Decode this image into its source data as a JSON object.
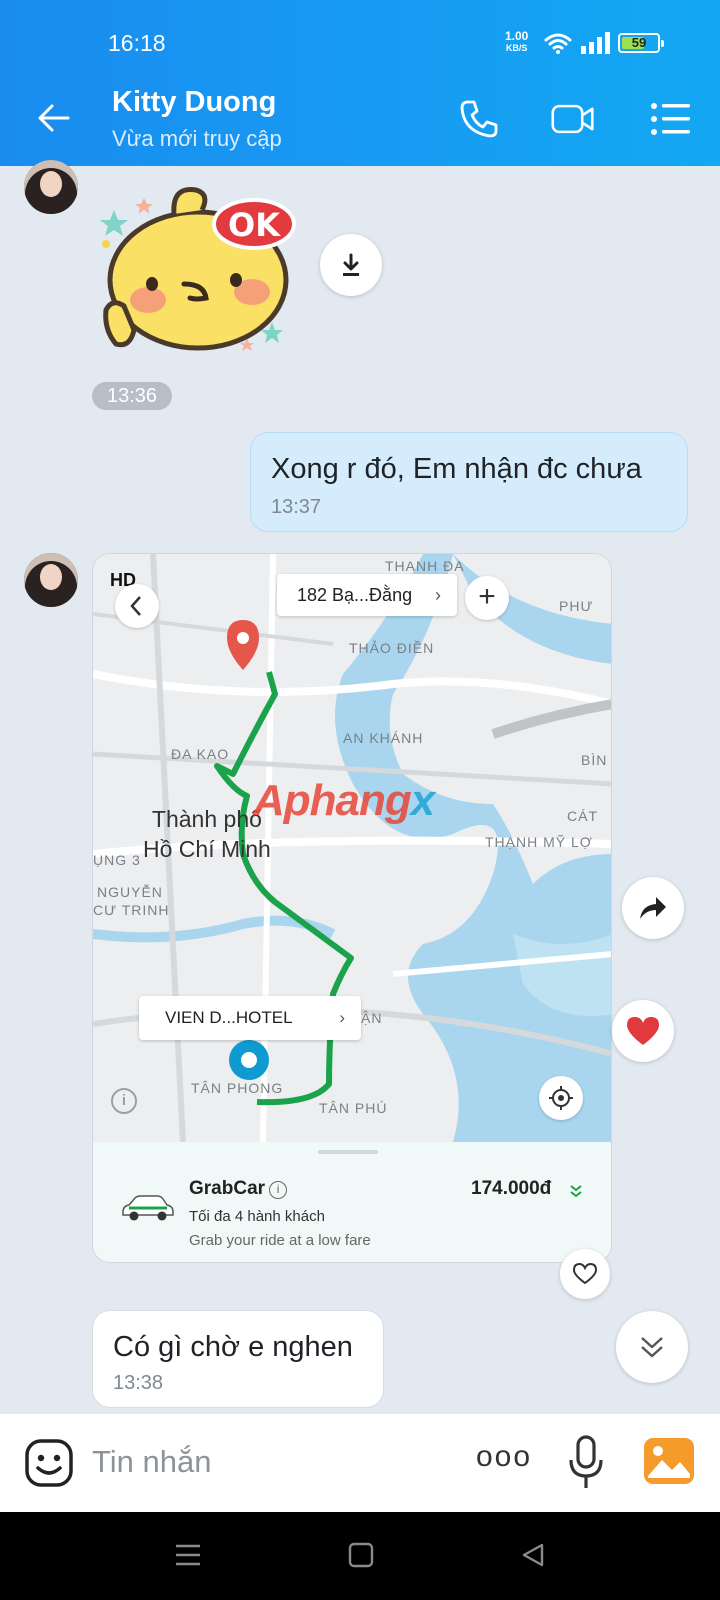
{
  "status_bar": {
    "time": "16:18",
    "net_speed_value": "1.00",
    "net_speed_unit": "KB/S",
    "battery": "59"
  },
  "header": {
    "contact_name": "Kitty Duong",
    "contact_status": "Vừa mới truy cập"
  },
  "messages": {
    "sticker_time": "13:36",
    "sent_text": "Xong r đó, Em nhận đc chưa",
    "sent_time": "13:37",
    "received_text": "Có gì chờ e nghen",
    "received_time": "13:38"
  },
  "map_card": {
    "hd_label": "HD",
    "address_chip": "182 Bạ...Đằng",
    "destination_chip": "VIEN D...HOTEL",
    "labels": {
      "thanh_da": "THANH ĐA",
      "phuoc": "PHƯ",
      "thao_dien": "THẢO ĐIỀN",
      "an_khanh": "AN KHÁNH",
      "binh": "BÌN",
      "da_kao": "ĐA KAO",
      "cat": "CÁT",
      "thanh_my_loi": "THẠNH MỸ LỢ",
      "ung3": "ỤNG 3",
      "nguyen": "NGUYỄN",
      "cu_trinh": "CƯ TRINH",
      "tan_phong": "TÂN PHONG",
      "tan_phu": "TÂN PHÚ",
      "nhuan": "ẬN",
      "city_line1": "Thành phố",
      "city_line2": "Hồ Chí Minh"
    },
    "watermark_a": "Aphang",
    "watermark_b": "x",
    "ride": {
      "name": "GrabCar",
      "capacity": "Tối đa 4 hành khách",
      "slogan": "Grab your ride at a low fare",
      "price": "174.000đ"
    },
    "route_color": "#1aa34a",
    "pin_color": "#e5574a",
    "origin_color": "#0f9bd2"
  },
  "input_bar": {
    "placeholder": "Tin nhắn",
    "more_dots": "ooo"
  },
  "colors": {
    "header": "#1a8cf0",
    "chat_background": "#e2e9f1",
    "sent_bubble": "#d5ecfd",
    "heart": "#e03a3e",
    "gallery_icon": "#f59b2b"
  }
}
